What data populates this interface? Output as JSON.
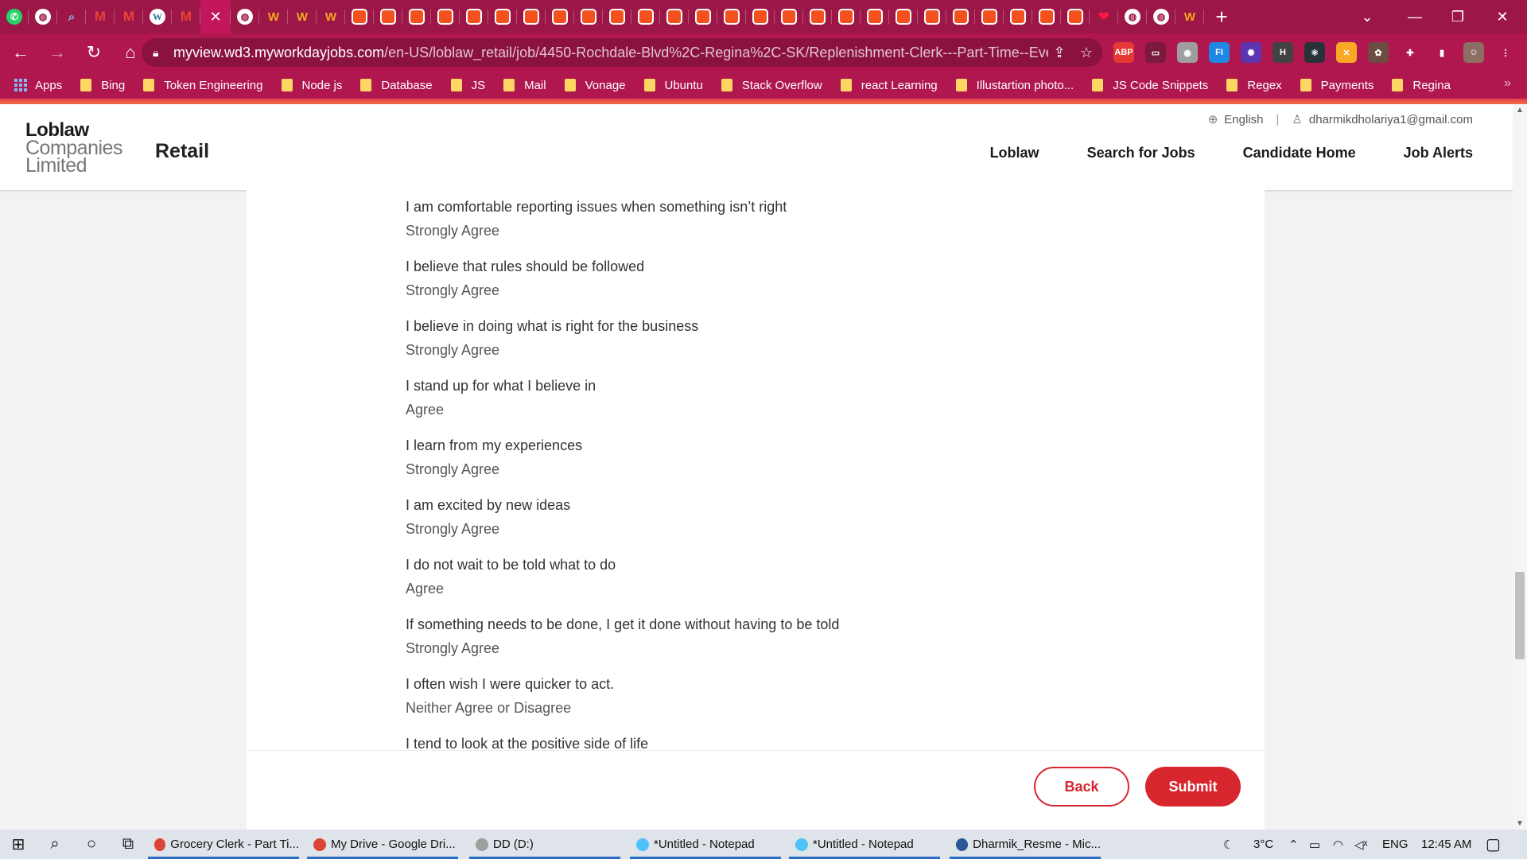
{
  "browser": {
    "tabs": [
      {
        "icon": "whatsapp-icon",
        "glyph": "✆",
        "style": "fav-whatsapp"
      },
      {
        "icon": "globe-icon",
        "glyph": "◍",
        "style": "fav-globe"
      },
      {
        "icon": "search-icon",
        "glyph": "⌕",
        "style": "fav-search"
      },
      {
        "icon": "gmail-icon",
        "glyph": "M",
        "style": "fav-gmail"
      },
      {
        "icon": "gmail-icon",
        "glyph": "M",
        "style": "fav-gmail"
      },
      {
        "icon": "wordpress-icon",
        "glyph": "W",
        "style": "fav-wp"
      },
      {
        "icon": "gmail-icon",
        "glyph": "M",
        "style": "fav-gmail"
      },
      {
        "icon": "close-icon",
        "glyph": "✕",
        "style": "active"
      },
      {
        "icon": "globe-icon",
        "glyph": "◍",
        "style": "fav-globe"
      },
      {
        "icon": "workday-icon",
        "glyph": "W",
        "style": "fav-wd"
      },
      {
        "icon": "workday-icon",
        "glyph": "W",
        "style": "fav-wd"
      },
      {
        "icon": "workday-icon",
        "glyph": "W",
        "style": "fav-wd"
      },
      {
        "icon": "pdf-tool-icon",
        "glyph": "",
        "style": "fav-red"
      },
      {
        "icon": "pdf-tool-icon",
        "glyph": "",
        "style": "fav-red"
      },
      {
        "icon": "pdf-tool-icon",
        "glyph": "",
        "style": "fav-red"
      },
      {
        "icon": "pdf-tool-icon",
        "glyph": "",
        "style": "fav-red"
      },
      {
        "icon": "pdf-tool-icon",
        "glyph": "",
        "style": "fav-red"
      },
      {
        "icon": "pdf-tool-icon",
        "glyph": "",
        "style": "fav-red"
      },
      {
        "icon": "pdf-tool-icon",
        "glyph": "",
        "style": "fav-red"
      },
      {
        "icon": "pdf-tool-icon",
        "glyph": "",
        "style": "fav-red"
      },
      {
        "icon": "pdf-tool-icon",
        "glyph": "",
        "style": "fav-red"
      },
      {
        "icon": "pdf-tool-icon",
        "glyph": "",
        "style": "fav-red"
      },
      {
        "icon": "pdf-tool-icon",
        "glyph": "",
        "style": "fav-red"
      },
      {
        "icon": "pdf-tool-icon",
        "glyph": "",
        "style": "fav-red"
      },
      {
        "icon": "pdf-tool-icon",
        "glyph": "",
        "style": "fav-red"
      },
      {
        "icon": "pdf-tool-icon",
        "glyph": "",
        "style": "fav-red"
      },
      {
        "icon": "pdf-tool-icon",
        "glyph": "",
        "style": "fav-red"
      },
      {
        "icon": "pdf-tool-icon",
        "glyph": "",
        "style": "fav-red"
      },
      {
        "icon": "pdf-tool-icon",
        "glyph": "",
        "style": "fav-red"
      },
      {
        "icon": "pdf-tool-icon",
        "glyph": "",
        "style": "fav-red"
      },
      {
        "icon": "pdf-tool-icon",
        "glyph": "",
        "style": "fav-red"
      },
      {
        "icon": "pdf-tool-icon",
        "glyph": "",
        "style": "fav-red"
      },
      {
        "icon": "pdf-tool-icon",
        "glyph": "",
        "style": "fav-red"
      },
      {
        "icon": "pdf-tool-icon",
        "glyph": "",
        "style": "fav-red"
      },
      {
        "icon": "pdf-tool-icon",
        "glyph": "",
        "style": "fav-red"
      },
      {
        "icon": "pdf-tool-icon",
        "glyph": "",
        "style": "fav-red"
      },
      {
        "icon": "pdf-tool-icon",
        "glyph": "",
        "style": "fav-red"
      },
      {
        "icon": "pdf-tool-icon",
        "glyph": "",
        "style": "fav-red"
      },
      {
        "icon": "heart-icon",
        "glyph": "❤",
        "style": "fav-heart"
      },
      {
        "icon": "globe-icon",
        "glyph": "◍",
        "style": "fav-globe"
      },
      {
        "icon": "globe-icon",
        "glyph": "◍",
        "style": "fav-globe"
      },
      {
        "icon": "workday-icon",
        "glyph": "W",
        "style": "fav-wd"
      }
    ],
    "url_host": "myview.wd3.myworkdayjobs.com",
    "url_path": "/en-US/loblaw_retail/job/4450-Rochdale-Blvd%2C-Regina%2C-SK/Replenishment-Clerk---Part-Time--Eve...",
    "extensions": [
      {
        "name": "adblock-icon",
        "label": "ABP",
        "color": "#e53935"
      },
      {
        "name": "screen-capture-icon",
        "label": "▭",
        "color": "#7a1a3c"
      },
      {
        "name": "camera-icon",
        "label": "◉",
        "color": "#9e9e9e"
      },
      {
        "name": "fi-extension-icon",
        "label": "FI",
        "color": "#1e88e5"
      },
      {
        "name": "color-picker-icon",
        "label": "✺",
        "color": "#5e35b1"
      },
      {
        "name": "h-extension-icon",
        "label": "H",
        "color": "#424242"
      },
      {
        "name": "react-devtools-icon",
        "label": "⚛",
        "color": "#263238"
      },
      {
        "name": "x-extension-icon",
        "label": "✕",
        "color": "#f9a825"
      },
      {
        "name": "leaf-extension-icon",
        "label": "✿",
        "color": "#6d4c41"
      },
      {
        "name": "puzzle-icon",
        "label": "✚",
        "color": "transparent"
      },
      {
        "name": "sidepanel-icon",
        "label": "▮",
        "color": "transparent"
      },
      {
        "name": "profile-avatar-icon",
        "label": "☺",
        "color": "#8d6e63"
      },
      {
        "name": "menu-kebab-icon",
        "label": "⋮",
        "color": "transparent"
      }
    ],
    "bookmarks": [
      "Bing",
      "Token Engineering",
      "Node js",
      "Database",
      "JS",
      "Mail",
      "Vonage",
      "Ubuntu",
      "Stack Overflow",
      "react Learning",
      "Illustartion photo...",
      "JS Code Snippets",
      "Regex",
      "Payments",
      "Regina"
    ],
    "apps_label": "Apps",
    "more_bookmarks": "»"
  },
  "site": {
    "logo_line1": "Loblaw",
    "logo_line2": "Companies",
    "logo_line3": "Limited",
    "title": "Retail",
    "language": "English",
    "user_email": "dharmikdholariya1@gmail.com",
    "nav": [
      "Loblaw",
      "Search for Jobs",
      "Candidate Home",
      "Job Alerts"
    ]
  },
  "questionnaire": [
    {
      "question": "I am comfortable reporting issues when something isn’t right",
      "answer": "Strongly Agree"
    },
    {
      "question": "I believe that rules should be followed",
      "answer": "Strongly Agree"
    },
    {
      "question": "I believe in doing what is right for the business",
      "answer": "Strongly Agree"
    },
    {
      "question": "I stand up for what I believe in",
      "answer": "Agree"
    },
    {
      "question": "I learn from my experiences",
      "answer": "Strongly Agree"
    },
    {
      "question": "I am excited by new ideas",
      "answer": "Strongly Agree"
    },
    {
      "question": "I do not wait to be told what to do",
      "answer": "Agree"
    },
    {
      "question": "If something needs to be done, I get it done without having to be told",
      "answer": "Strongly Agree"
    },
    {
      "question": "I often wish I were quicker to act.",
      "answer": "Neither Agree or Disagree"
    },
    {
      "question": "I tend to look at the positive side of life",
      "answer": ""
    }
  ],
  "actions": {
    "back": "Back",
    "submit": "Submit"
  },
  "taskbar": {
    "items": [
      {
        "label": "Grocery Clerk - Part Ti...",
        "color": "#db4437"
      },
      {
        "label": "My Drive - Google Dri...",
        "color": "#db4437"
      },
      {
        "label": "DD (D:)",
        "color": "#9e9e9e"
      },
      {
        "label": "*Untitled - Notepad",
        "color": "#4fc3f7"
      },
      {
        "label": "*Untitled - Notepad",
        "color": "#4fc3f7"
      },
      {
        "label": "Dharmik_Resme - Mic...",
        "color": "#2b579a"
      }
    ],
    "temperature": "3°C",
    "language": "ENG",
    "time": "12:45 AM"
  },
  "colors": {
    "accent_red": "#d8262f",
    "browser_frame": "#9c1748"
  }
}
